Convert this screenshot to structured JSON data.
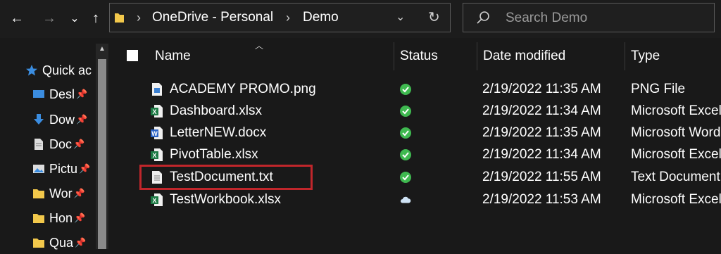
{
  "navigation": {
    "back": "←",
    "forward": "→",
    "recent": "⌄",
    "up": "↑"
  },
  "address_bar": {
    "segments": [
      "OneDrive - Personal",
      "Demo"
    ],
    "separator": "›",
    "dropdown": "⌄",
    "refresh": "↻"
  },
  "search": {
    "placeholder": "Search Demo"
  },
  "sidebar": {
    "items": [
      {
        "label": "Quick ac",
        "icon": "star-icon",
        "pinned": false
      },
      {
        "label": "Desl",
        "icon": "desktop-icon",
        "pinned": true
      },
      {
        "label": "Dow",
        "icon": "download-icon",
        "pinned": true
      },
      {
        "label": "Doc",
        "icon": "document-icon",
        "pinned": true
      },
      {
        "label": "Pictu",
        "icon": "pictures-icon",
        "pinned": true
      },
      {
        "label": "Wor",
        "icon": "folder-icon",
        "pinned": true
      },
      {
        "label": "Hon",
        "icon": "folder-icon",
        "pinned": true
      },
      {
        "label": "Qua",
        "icon": "folder-icon",
        "pinned": true
      }
    ],
    "pin_glyph": "📌"
  },
  "columns": {
    "name": "Name",
    "status": "Status",
    "date_modified": "Date modified",
    "type": "Type"
  },
  "files": [
    {
      "name": "ACADEMY PROMO.png",
      "icon": "image-file-icon",
      "status": "synced",
      "date": "2/19/2022 11:35 AM",
      "type": "PNG File"
    },
    {
      "name": "Dashboard.xlsx",
      "icon": "excel-file-icon",
      "status": "synced",
      "date": "2/19/2022 11:34 AM",
      "type": "Microsoft Excel"
    },
    {
      "name": "LetterNEW.docx",
      "icon": "word-file-icon",
      "status": "synced",
      "date": "2/19/2022 11:35 AM",
      "type": "Microsoft Word"
    },
    {
      "name": "PivotTable.xlsx",
      "icon": "excel-file-icon",
      "status": "synced",
      "date": "2/19/2022 11:34 AM",
      "type": "Microsoft Excel"
    },
    {
      "name": "TestDocument.txt",
      "icon": "text-file-icon",
      "status": "synced",
      "date": "2/19/2022 11:55 AM",
      "type": "Text Document"
    },
    {
      "name": "TestWorkbook.xlsx",
      "icon": "excel-file-icon",
      "status": "cloud",
      "date": "2/19/2022 11:53 AM",
      "type": "Microsoft Excel"
    }
  ],
  "colors": {
    "background": "#191919",
    "synced": "#3fb950",
    "cloud": "#cfe3f5",
    "highlight": "#c0262b",
    "folder": "#f2c84b",
    "excel": "#1d7a45",
    "word": "#2b63c6"
  }
}
